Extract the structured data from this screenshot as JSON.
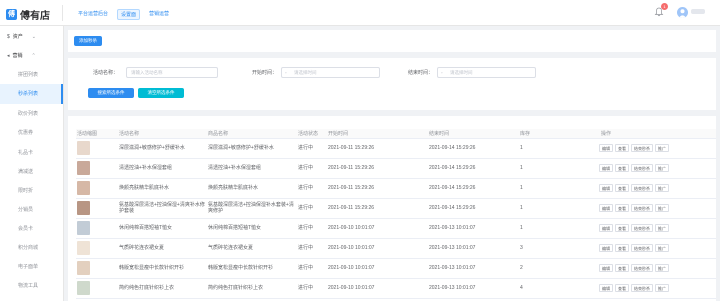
{
  "header": {
    "logo_mark": "傅",
    "logo_text": "傅有店",
    "nav": [
      {
        "label": "平台运营后台",
        "active": false
      },
      {
        "label": "设置面",
        "active": true
      },
      {
        "label": "营销运营",
        "active": false
      }
    ],
    "notification_count": "1"
  },
  "sidebar": {
    "groups": [
      {
        "label": "资产",
        "icon": "currency-icon"
      },
      {
        "label": "营销",
        "icon": "megaphone-icon"
      }
    ],
    "items": [
      {
        "label": "拼团列表",
        "active": false
      },
      {
        "label": "秒杀列表",
        "active": true
      },
      {
        "label": "砍价列表",
        "active": false
      },
      {
        "label": "优惠券",
        "active": false
      },
      {
        "label": "礼品卡",
        "active": false
      },
      {
        "label": "满减送",
        "active": false
      },
      {
        "label": "限时折",
        "active": false
      },
      {
        "label": "分销员",
        "active": false
      },
      {
        "label": "会员卡",
        "active": false
      },
      {
        "label": "积分商城",
        "active": false
      },
      {
        "label": "电子面单",
        "active": false
      },
      {
        "label": "物流工具",
        "active": false
      }
    ]
  },
  "toolbar": {
    "add_label": "添加秒杀"
  },
  "filters": {
    "name_label": "活动名称：",
    "name_placeholder": "请输入活动名称",
    "start_label": "开始时间：",
    "start_placeholder": "请选择时间",
    "end_label": "结束时间：",
    "end_placeholder": "请选择时间",
    "search_label": "搜索所选条件",
    "clear_label": "清空所选条件"
  },
  "table": {
    "columns": [
      "活动缩图",
      "活动名称",
      "商品名称",
      "活动状态",
      "开始时间",
      "结束时间",
      "库存",
      "操作"
    ],
    "actions": [
      "编辑",
      "查看",
      "结束秒杀",
      "推广"
    ],
    "rows": [
      {
        "name": "深层滋润+敏感修护+舒缓补水",
        "product": "深层滋润+敏感修护+舒缓补水",
        "status": "进行中",
        "start": "2021-09-11 15:29:26",
        "end": "2021-09-14 15:29:26",
        "stock": "1",
        "thumb": "#e8d8cc"
      },
      {
        "name": "清透控油+补水保湿套组",
        "product": "清透控油+补水保湿套组",
        "status": "进行中",
        "start": "2021-09-11 15:29:26",
        "end": "2021-09-14 15:29:26",
        "stock": "1",
        "thumb": "#c9a99a"
      },
      {
        "name": "焕颜亮肤精华肌底补水",
        "product": "焕颜亮肤精华肌底补水",
        "status": "进行中",
        "start": "2021-09-11 15:29:26",
        "end": "2021-09-14 15:29:26",
        "stock": "1",
        "thumb": "#d6b8a6"
      },
      {
        "name": "氨基酸深层清洁+控油保湿+清爽补水修护套装",
        "product": "氨基酸深层清洁+控油保湿补水套装+清爽修护",
        "status": "进行中",
        "start": "2021-09-11 15:29:26",
        "end": "2021-09-14 15:29:26",
        "stock": "1",
        "thumb": "#b89684"
      },
      {
        "name": "休闲纯棉百搭短袖T恤女",
        "product": "休闲纯棉百搭短袖T恤女",
        "status": "进行中",
        "start": "2021-09-10 10:01:07",
        "end": "2021-09-13 10:01:07",
        "stock": "1",
        "thumb": "#c2ccd6"
      },
      {
        "name": "气质碎花连衣裙女夏",
        "product": "气质碎花连衣裙女夏",
        "status": "进行中",
        "start": "2021-09-10 10:01:07",
        "end": "2021-09-13 10:01:07",
        "stock": "3",
        "thumb": "#efe3d6"
      },
      {
        "name": "韩版宽松显瘦中长款针织开衫",
        "product": "韩版宽松显瘦中长款针织开衫",
        "status": "进行中",
        "start": "2021-09-10 10:01:07",
        "end": "2021-09-13 10:01:07",
        "stock": "2",
        "thumb": "#e3d0bf"
      },
      {
        "name": "简约纯色打底针织衫上衣",
        "product": "简约纯色打底针织衫上衣",
        "status": "进行中",
        "start": "2021-09-10 10:01:07",
        "end": "2021-09-13 10:01:07",
        "stock": "4",
        "thumb": "#cfd9cc"
      }
    ]
  }
}
